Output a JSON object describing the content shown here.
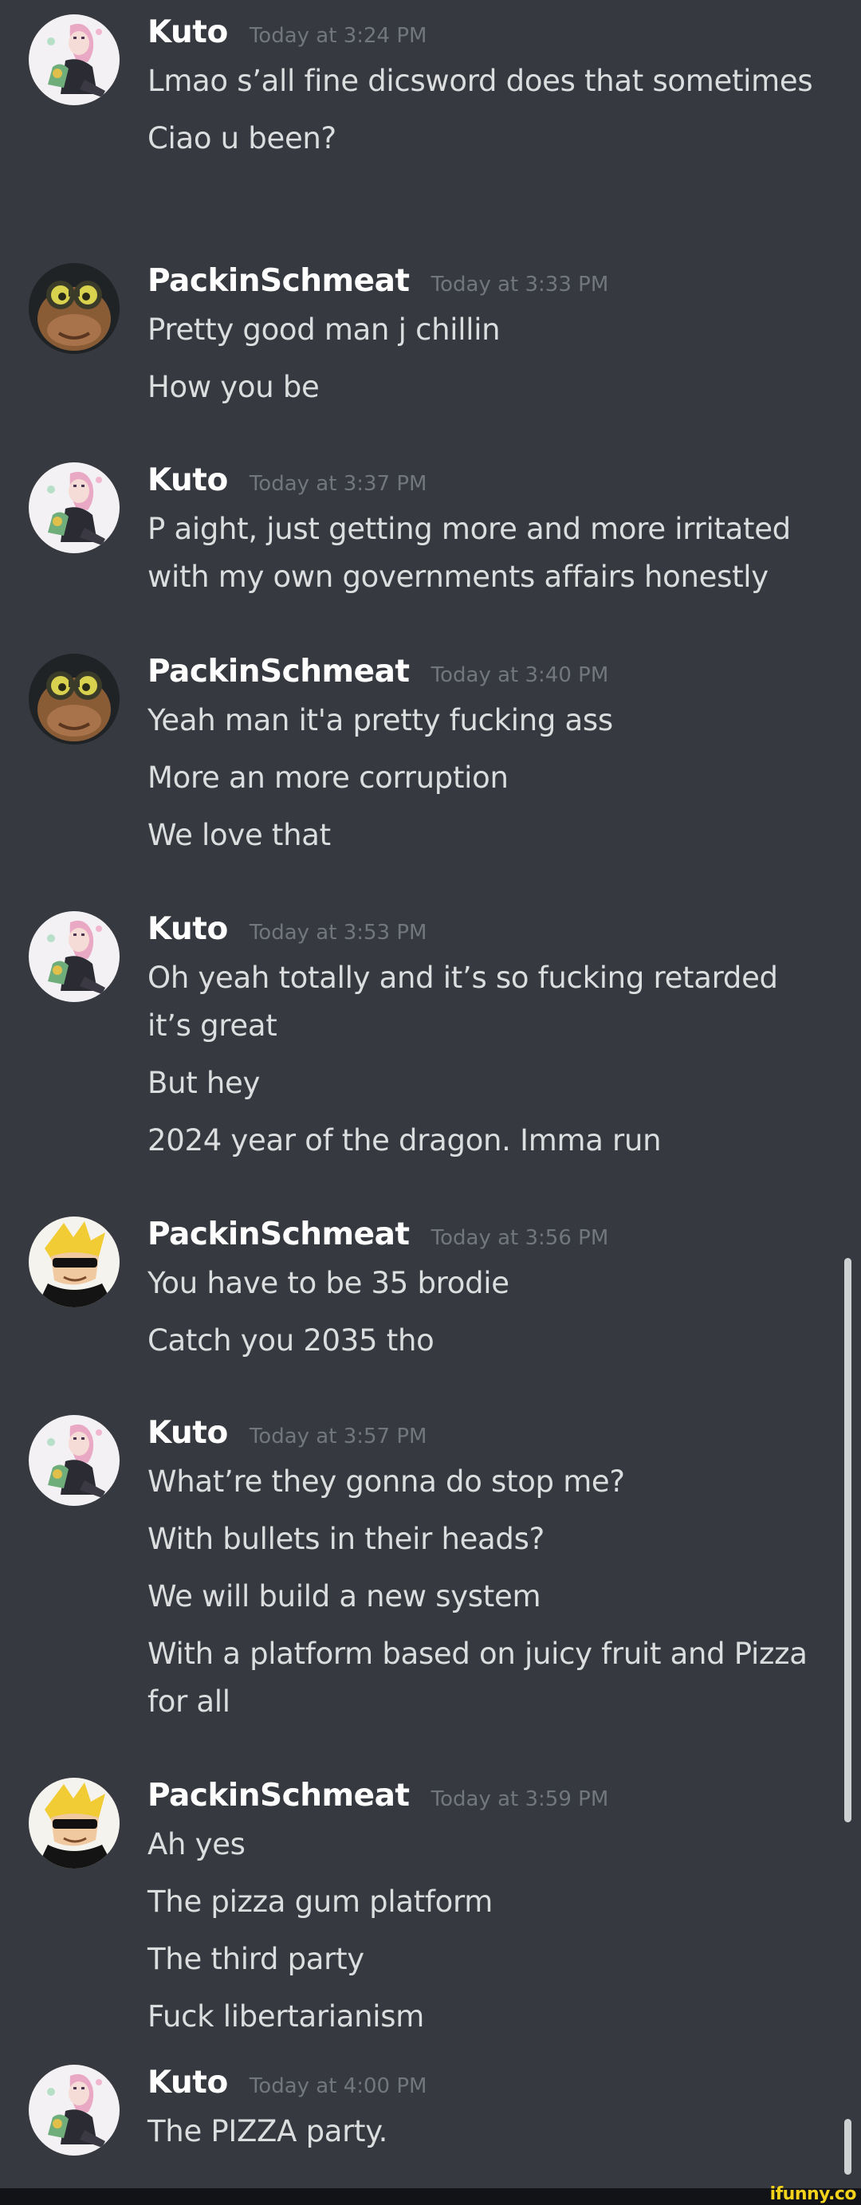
{
  "users": {
    "kuto": {
      "name": "Kuto",
      "avatar_icon": "anime-character-avatar"
    },
    "packin": {
      "name": "PackinSchmeat"
    }
  },
  "messages": [
    {
      "author": "Kuto",
      "time": "Today at 3:24 PM",
      "avatar": "kuto-anime-avatar",
      "lines": [
        "Lmao s’all fine dicsword does that sometimes",
        "Ciao u been?"
      ]
    },
    {
      "author": "PackinSchmeat",
      "time": "Today at 3:33 PM",
      "avatar": "goggles-creature-avatar",
      "lines": [
        "Pretty good man j chillin",
        "How you be"
      ]
    },
    {
      "author": "Kuto",
      "time": "Today at 3:37 PM",
      "avatar": "kuto-anime-avatar",
      "lines": [
        "P aight, just getting more and more irritated with my own governments affairs honestly"
      ]
    },
    {
      "author": "PackinSchmeat",
      "time": "Today at 3:40 PM",
      "avatar": "goggles-creature-avatar",
      "lines": [
        "Yeah man it'a pretty fucking ass",
        "More an more corruption",
        "We love that"
      ]
    },
    {
      "author": "Kuto",
      "time": "Today at 3:53 PM",
      "avatar": "kuto-anime-avatar",
      "lines": [
        "Oh yeah totally and it’s so fucking retarded it’s great",
        "But hey",
        "2024 year of the dragon. Imma run"
      ]
    },
    {
      "author": "PackinSchmeat",
      "time": "Today at 3:56 PM",
      "avatar": "cartoon-hero-avatar",
      "lines": [
        "You have to be 35 brodie",
        "Catch you 2035 tho"
      ]
    },
    {
      "author": "Kuto",
      "time": "Today at 3:57 PM",
      "avatar": "kuto-anime-avatar",
      "lines": [
        "What’re they gonna do stop me?",
        "With bullets in their heads?",
        "We will build a new system",
        "With a platform based on juicy fruit and Pizza for all"
      ]
    },
    {
      "author": "PackinSchmeat",
      "time": "Today at 3:59 PM",
      "avatar": "cartoon-hero-avatar",
      "lines": [
        "Ah yes",
        "The pizza gum platform",
        "The third party",
        "Fuck libertarianism"
      ]
    },
    {
      "author": "Kuto",
      "time": "Today at 4:00 PM",
      "avatar": "kuto-anime-avatar",
      "lines": [
        "The PIZZA party."
      ]
    }
  ],
  "watermark": "ifunny.co",
  "colors": {
    "background": "#36393f",
    "username": "#ffffff",
    "timestamp": "#72767d",
    "message_text": "#dcddde",
    "watermark": "#f2d21a"
  }
}
